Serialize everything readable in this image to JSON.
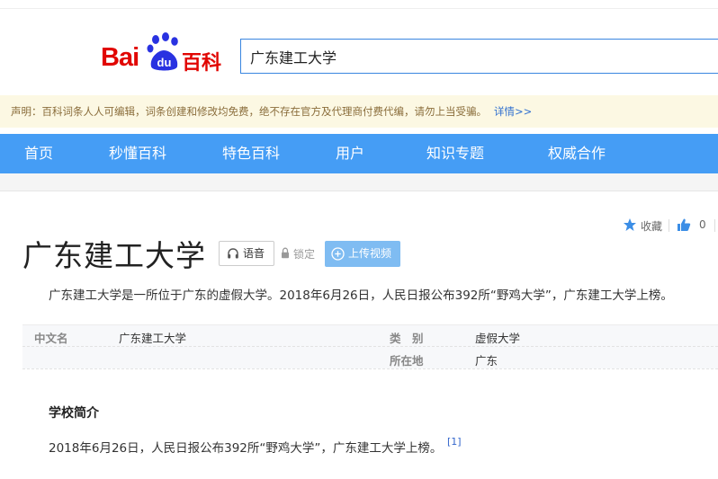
{
  "logo": {
    "bai": "Bai",
    "du": "du",
    "baike": "百科"
  },
  "search": {
    "value": "广东建工大学"
  },
  "notice": {
    "text": "声明：百科词条人人可编辑，词条创建和修改均免费，绝不存在官方及代理商付费代编，请勿上当受骗。",
    "more": "详情>>"
  },
  "nav": {
    "items": [
      "首页",
      "秒懂百科",
      "特色百科",
      "用户",
      "知识专题",
      "权威合作"
    ]
  },
  "tools": {
    "fav": "收藏",
    "like_count": "0"
  },
  "title": "广东建工大学",
  "buttons": {
    "voice": "语音",
    "lock": "锁定",
    "upload": "上传视频"
  },
  "summary": "广东建工大学是一所位于广东的虚假大学。2018年6月26日，人民日报公布392所“野鸡大学”，广东建工大学上榜。",
  "infobox": {
    "rows": [
      {
        "key": "中文名",
        "value": "广东建工大学",
        "key2": "类　别",
        "value2": "虚假大学"
      },
      {
        "key2": "所在地",
        "value2": "广东"
      }
    ]
  },
  "section": {
    "title": "学校简介"
  },
  "paragraph": "2018年6月26日，人民日报公布392所“野鸡大学”，广东建工大学上榜。",
  "citation": "[1]",
  "colors": {
    "brand_red": "#e10602",
    "nav_blue": "#459df5",
    "link_blue": "#2f6fcf"
  }
}
